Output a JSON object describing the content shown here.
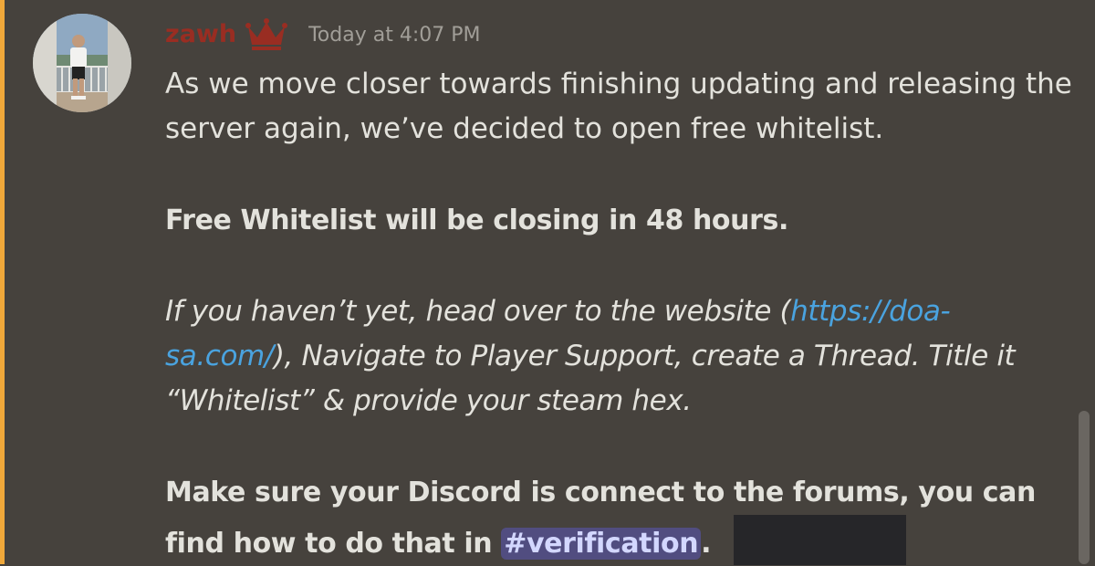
{
  "message": {
    "author": "zawh",
    "author_icon": "crown-icon",
    "timestamp": "Today at 4:07 PM",
    "intro": "As we move closer towards finishing updating and releasing the server again, we’ve decided to open free whitelist.",
    "notice": "Free Whitelist will be closing in 48 hours.",
    "instructions_before_link": "If you haven’t yet, head over to the website (",
    "link_text": "https://doa-sa.com/",
    "instructions_after_link": "), Navigate to Player Support, create a Thread. Title it “Whitelist” & provide your steam hex.",
    "verify_before_channel": "Make sure your Discord is connect to the forums, you can find how to do that in ",
    "channel_mention": "#verification",
    "verify_after_channel": "."
  },
  "colors": {
    "background": "#46423d",
    "mention_highlight_bar": "#f0a83a",
    "username": "#992d22",
    "link": "#4aa3df",
    "channel_mention_bg": "#514d80"
  }
}
